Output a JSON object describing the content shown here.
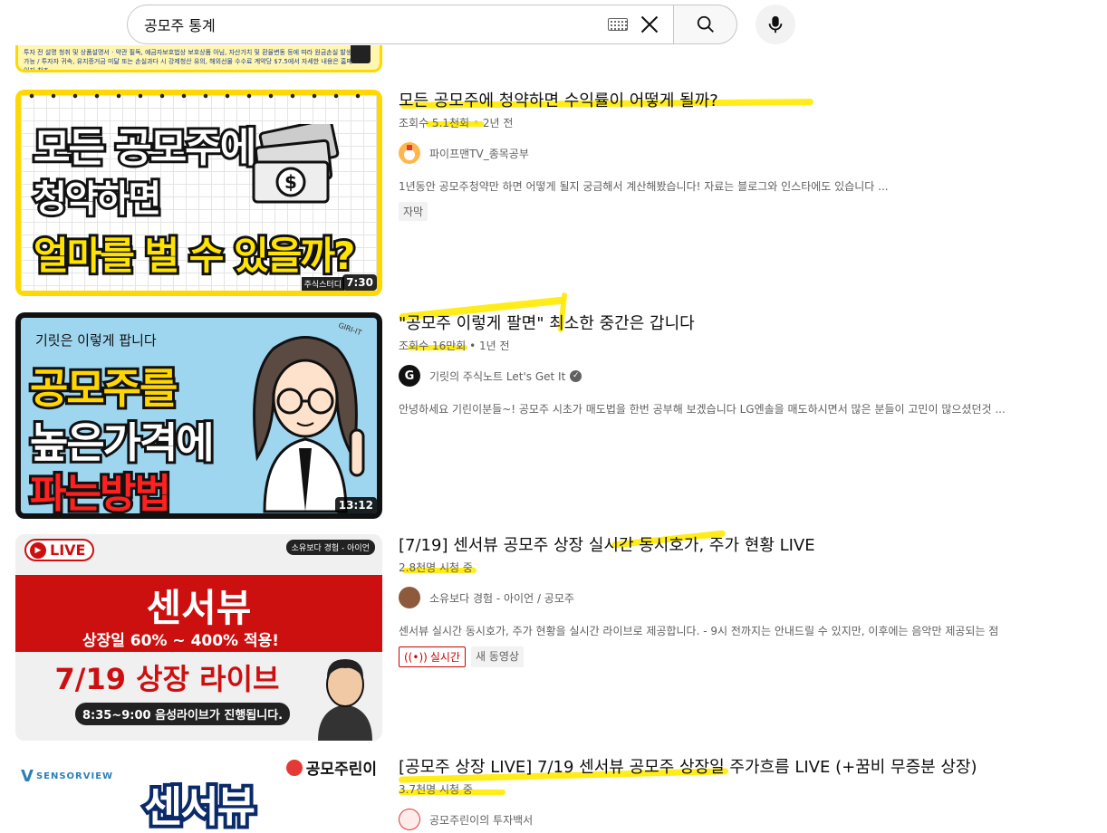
{
  "search": {
    "query": "공모주 통계"
  },
  "results": [
    {
      "title": "모든 공모주에 청약하면 수익률이 어떻게 될까?",
      "views": "조회수 5.1천회",
      "age": "2년 전",
      "channel": "파이프맨TV_종목공부",
      "description": "1년동안 공모주청약만 하면 어떻게 될지 궁금해서 계산해봤습니다! 자료는 블로그와 인스타에도 있습니다 ...",
      "badges": [
        "자막"
      ],
      "duration": "7:30",
      "thumb_lines": [
        "모든 공모주에",
        "청약하면",
        "얼마를 벌 수 있을까?"
      ],
      "thumb_tag": "주식스터디"
    },
    {
      "title": "\"공모주 이렇게 팔면\" 최소한 중간은 갑니다",
      "views": "조회수 16만회",
      "age": "1년 전",
      "channel": "기릿의 주식노트 Let's Get It",
      "verified": true,
      "description": "안녕하세요 기린이분들~! 공모주 시초가 매도법을 한번 공부해 보겠습니다 LG엔솔을 매도하시면서 많은 분들이 고민이 많으셨던것 ...",
      "duration": "13:12",
      "thumb_lines": [
        "기릿은 이렇게 팝니다",
        "공모주를",
        "높은가격에",
        "파는방법"
      ],
      "thumb_tag": "GIRI-IT"
    },
    {
      "title": "[7/19] 센서뷰 공모주 상장 실시간 동시호가, 주가 현황 LIVE",
      "views": "2.8천명 시청 중",
      "channel": "소유보다 경험 - 아이언 / 공모주",
      "description": "센서뷰 실시간 동시호가, 주가 현황을 실시간 라이브로 제공합니다. - 9시 전까지는 안내드릴 수 있지만, 이후에는 음악만 제공되는 점",
      "badges": [
        "실시간",
        "새 동영상"
      ],
      "thumb_lines": [
        "LIVE",
        "소유보다 경험 - 아이언",
        "센서뷰",
        "상장일 60% ~ 400% 적용!",
        "7/19 상장 라이브",
        "8:35~9:00 음성라이브가 진행됩니다."
      ]
    },
    {
      "title": "[공모주 상장 LIVE] 7/19 센서뷰 공모주 상장일 주가흐름 LIVE (+꿈비 무증분 상장)",
      "views": "3.7천명 시청 중",
      "channel": "공모주린이의 투자백서",
      "thumb_lines": [
        "SENSORVIEW",
        "공모주린이",
        "센서뷰"
      ]
    }
  ],
  "top_thumb_strip": "투자 전 설명 청취 및 상품설명서 · 약관 필독, 예금자보호법상 보호상품 아님, 자산가치 및 환율변동 등에 따라 원금손실 발생 가능 / 투자자 귀속, 유지증거금 미달 또는 손실과다 시 강제청산 유의, 해외선물 수수료 계약당 $7.5에서 자세한 내용은 홈페이지 참조",
  "colors": {
    "highlight": "#ffea00",
    "live_red": "#cc0000",
    "thumb1_yellow": "#ffd800",
    "thumb2_blue": "#9fd6ef",
    "thumb3_red": "#cc1010"
  }
}
